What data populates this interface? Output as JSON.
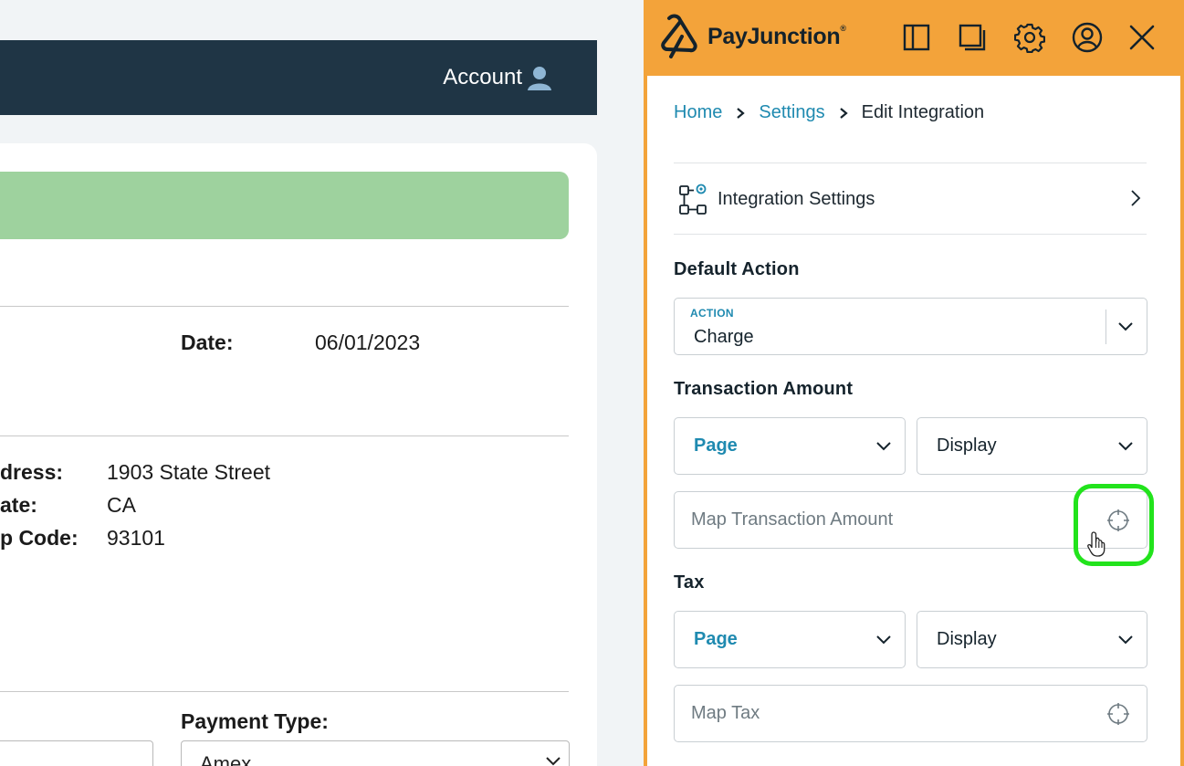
{
  "background_page": {
    "account_label": "Account",
    "date_label": "Date:",
    "date_value": "06/01/2023",
    "address_label": "dress:",
    "address_value": "1903 State Street",
    "state_label": "ate:",
    "state_value": "CA",
    "zip_label": "p Code:",
    "zip_value": "93101",
    "payment_type_label": "Payment Type:",
    "payment_type_value": "Amex"
  },
  "panel": {
    "brand": "PayJunction",
    "brand_mark": "®",
    "icons": [
      "sidebar-layout-icon",
      "popout-window-icon",
      "gear-icon",
      "user-circle-icon",
      "close-icon"
    ],
    "breadcrumb": [
      {
        "label": "Home"
      },
      {
        "label": "Settings"
      },
      {
        "label": "Edit Integration"
      }
    ],
    "integration_settings_label": "Integration Settings",
    "default_action": {
      "title": "Default Action",
      "field_label": "ACTION",
      "value": "Charge"
    },
    "transaction_amount": {
      "title": "Transaction Amount",
      "source": "Page",
      "mode": "Display",
      "placeholder": "Map Transaction Amount"
    },
    "tax": {
      "title": "Tax",
      "source": "Page",
      "mode": "Display",
      "placeholder": "Map Tax"
    }
  },
  "colors": {
    "panel_orange": "#f3a33a",
    "link_blue": "#1f8ab0",
    "nav_dark": "#1f3545",
    "success_green": "#9ed29e",
    "highlight_green": "#22e31c"
  }
}
